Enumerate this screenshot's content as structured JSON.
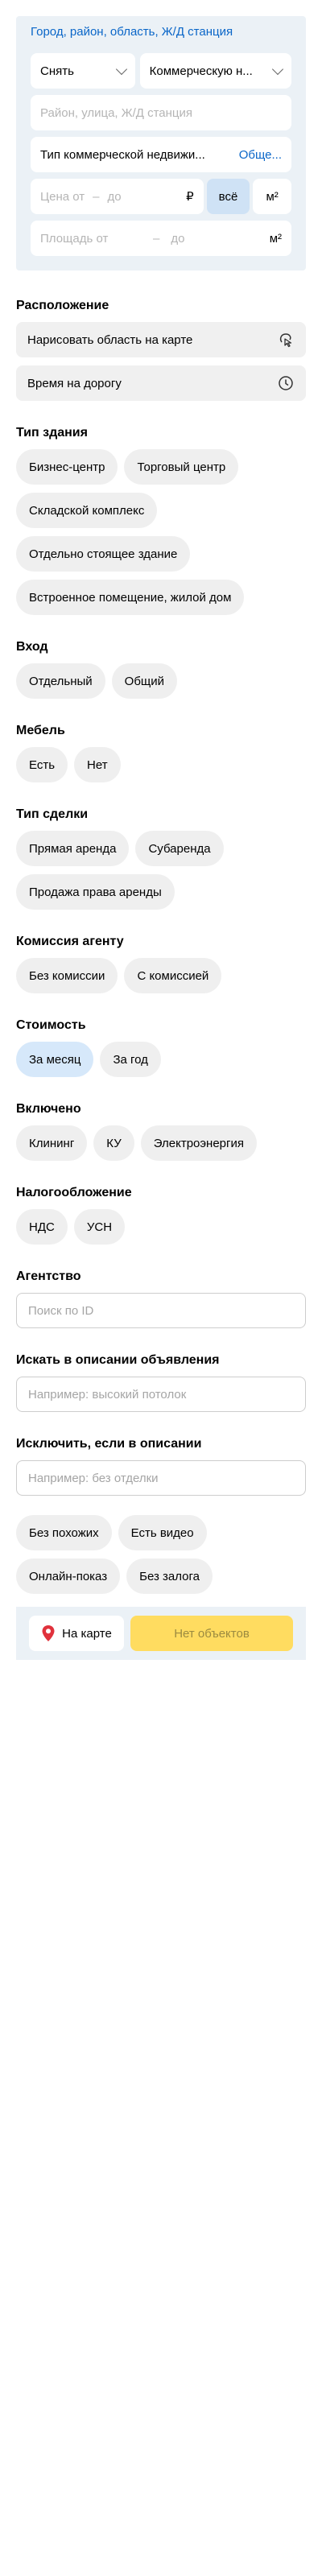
{
  "search": {
    "geo_link": "Город, район, область, Ж/Д станция",
    "deal_select": "Снять",
    "category_select": "Коммерческую н...",
    "address_placeholder": "Район, улица, Ж/Д станция",
    "property_type": "Тип коммерческой недвижи...",
    "property_type_link": "Обще...",
    "price_from_placeholder": "Цена от",
    "price_to_placeholder": "до",
    "currency": "₽",
    "price_scope_all": "всё",
    "price_scope_m2": "м²",
    "area_from_placeholder": "Площадь от",
    "area_to_placeholder": "до",
    "area_unit": "м²"
  },
  "filters": {
    "location": {
      "title": "Расположение",
      "draw_area": "Нарисовать область на карте",
      "travel_time": "Время на дорогу",
      "draw_icon": "draw-area-icon",
      "time_icon": "clock-icon"
    },
    "building_type": {
      "title": "Тип здания",
      "options": [
        "Бизнес-центр",
        "Торговый центр",
        "Складской комплекс",
        "Отдельно стоящее здание",
        "Встроенное помещение, жилой дом"
      ]
    },
    "entrance": {
      "title": "Вход",
      "options": [
        "Отдельный",
        "Общий"
      ]
    },
    "furniture": {
      "title": "Мебель",
      "options": [
        "Есть",
        "Нет"
      ]
    },
    "deal_type": {
      "title": "Тип сделки",
      "options": [
        "Прямая аренда",
        "Субаренда",
        "Продажа права аренды"
      ]
    },
    "commission": {
      "title": "Комиссия агенту",
      "options": [
        "Без комиссии",
        "С комиссией"
      ]
    },
    "cost": {
      "title": "Стоимость",
      "options": [
        "За месяц",
        "За год"
      ],
      "selected": "За месяц"
    },
    "included": {
      "title": "Включено",
      "options": [
        "Клининг",
        "КУ",
        "Электроэнергия"
      ]
    },
    "taxation": {
      "title": "Налогообложение",
      "options": [
        "НДС",
        "УСН"
      ]
    },
    "agency": {
      "title": "Агентство",
      "placeholder": "Поиск по ID"
    },
    "search_description": {
      "title": "Искать в описании объявления",
      "placeholder": "Например: высокий потолок"
    },
    "exclude_description": {
      "title": "Исключить, если в описании",
      "placeholder": "Например: без отделки"
    },
    "extras": {
      "options": [
        "Без похожих",
        "Есть видео",
        "Онлайн-показ",
        "Без залога"
      ]
    }
  },
  "bottom": {
    "map_button": "На карте",
    "map_icon": "map-pin-icon",
    "submit": "Нет объектов"
  },
  "colors": {
    "panel_bg": "#ebf1f6",
    "link": "#0a66c8",
    "chip_bg": "#efefef",
    "chip_active": "#d6e8fa",
    "submit_bg": "#ffdc60",
    "pin": "#e0323c"
  }
}
